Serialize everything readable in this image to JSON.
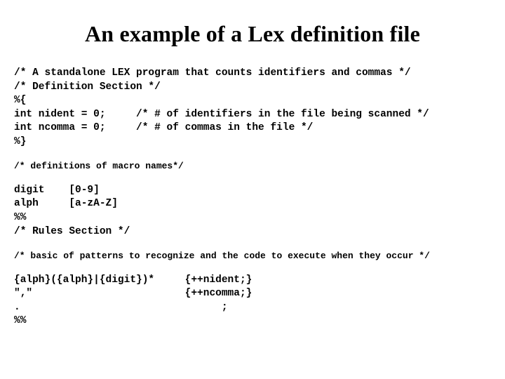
{
  "title": "An example of a Lex definition file",
  "block1": "/* A standalone LEX program that counts identifiers and commas */\n/* Definition Section */\n%{\nint nident = 0;     /* # of identifiers in the file being scanned */\nint ncomma = 0;     /* # of commas in the file */\n%}",
  "block2a": "/* definitions of macro names*/",
  "block2b": "digit    [0-9]\nalph     [a-zA-Z]\n%%\n/* Rules Section */",
  "block2c": "/* basic of patterns to recognize and the code to execute when they occur */",
  "block2d": "{alph}({alph}|{digit})*     {++nident;}\n\",\"                         {++ncomma;}\n.                                 ;\n%%"
}
